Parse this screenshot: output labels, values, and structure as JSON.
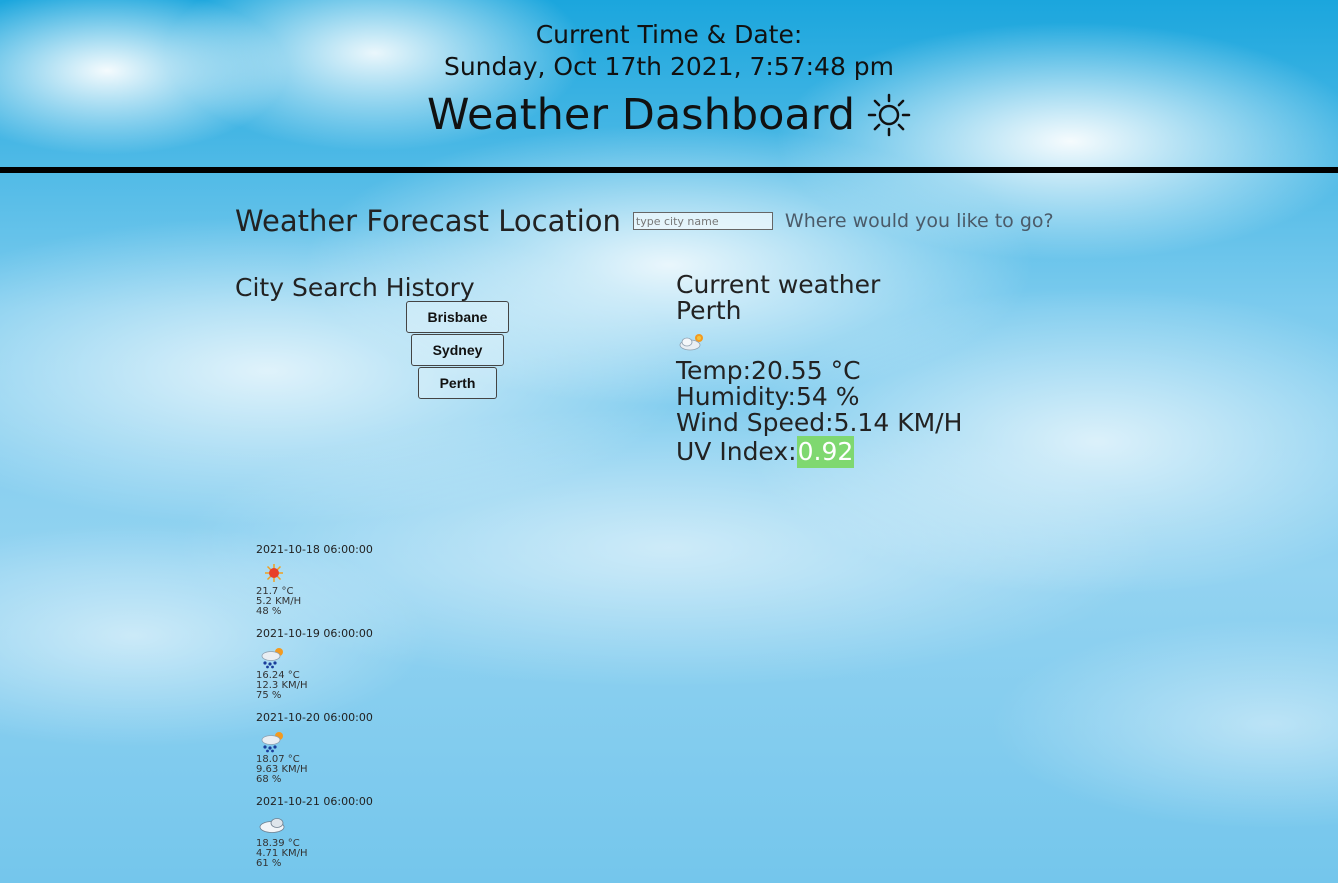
{
  "header": {
    "time_label": "Current Time & Date:",
    "time_value": "Sunday, Oct 17th 2021, 7:57:48 pm",
    "title": "Weather Dashboard",
    "title_icon": "sun-icon"
  },
  "search": {
    "title": "Weather Forecast Location",
    "placeholder": "type city name",
    "hint": "Where would you like to go?"
  },
  "history": {
    "title": "City Search History",
    "cities": [
      "Brisbane",
      "Sydney",
      "Perth"
    ]
  },
  "current": {
    "heading": "Current weather",
    "city": "Perth",
    "icon": "partly-cloudy-night-icon",
    "temp": "Temp:20.55 °C",
    "humidity": "Humidity:54 %",
    "wind_label": "Wind Speed:",
    "wind_value": "5.14 KM/H",
    "uv_label": "UV Index:",
    "uv_value": "0.92",
    "uv_color": "#7fd870"
  },
  "forecast": [
    {
      "date": "2021-10-18 06:00:00",
      "icon": "sun-icon",
      "temp": "21.7 °C",
      "wind": "5.2 KM/H",
      "humidity": "48 %"
    },
    {
      "date": "2021-10-19 06:00:00",
      "icon": "rain-sun-icon",
      "temp": "16.24 °C",
      "wind": "12.3 KM/H",
      "humidity": "75 %"
    },
    {
      "date": "2021-10-20 06:00:00",
      "icon": "rain-sun-icon",
      "temp": "18.07 °C",
      "wind": "9.63 KM/H",
      "humidity": "68 %"
    },
    {
      "date": "2021-10-21 06:00:00",
      "icon": "cloud-icon",
      "temp": "18.39 °C",
      "wind": "4.71 KM/H",
      "humidity": "61 %"
    }
  ],
  "colors": {
    "divider": "#000000",
    "uv_good": "#7fd870",
    "sky": "#74c6ec"
  }
}
